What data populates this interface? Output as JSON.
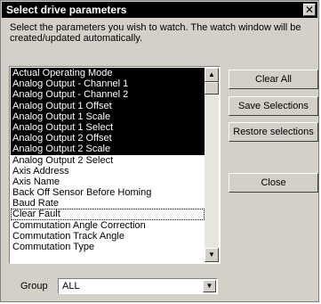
{
  "window": {
    "title": "Select drive parameters",
    "close_glyph": "✕"
  },
  "description": "Select the parameters you wish to watch.  The watch window will be created/updated automatically.",
  "list": {
    "items": [
      {
        "label": "Actual Operating Mode",
        "selected": true
      },
      {
        "label": "Analog Output - Channel 1",
        "selected": true
      },
      {
        "label": "Analog Output - Channel 2",
        "selected": true
      },
      {
        "label": "Analog Output 1 Offset",
        "selected": true
      },
      {
        "label": "Analog Output 1 Scale",
        "selected": true
      },
      {
        "label": "Analog Output 1 Select",
        "selected": true
      },
      {
        "label": "Analog Output 2 Offset",
        "selected": true
      },
      {
        "label": "Analog Output 2 Scale",
        "selected": true
      },
      {
        "label": "Analog Output 2 Select",
        "selected": false
      },
      {
        "label": "Axis Address",
        "selected": false
      },
      {
        "label": "Axis Name",
        "selected": false
      },
      {
        "label": "Back Off Sensor Before Homing",
        "selected": false
      },
      {
        "label": "Baud Rate",
        "selected": false
      },
      {
        "label": "Clear Fault",
        "selected": false,
        "focused": true
      },
      {
        "label": "Commutation Angle Correction",
        "selected": false
      },
      {
        "label": "Commutation Track Angle",
        "selected": false
      },
      {
        "label": "Commutation Type",
        "selected": false
      }
    ]
  },
  "buttons": {
    "clear_all": "Clear All",
    "save": "Save Selections",
    "restore": "Restore selections",
    "close": "Close"
  },
  "group": {
    "label": "Group",
    "value": "ALL"
  },
  "icons": {
    "scroll_up": "▲",
    "scroll_down": "▼",
    "dropdown": "▼"
  }
}
